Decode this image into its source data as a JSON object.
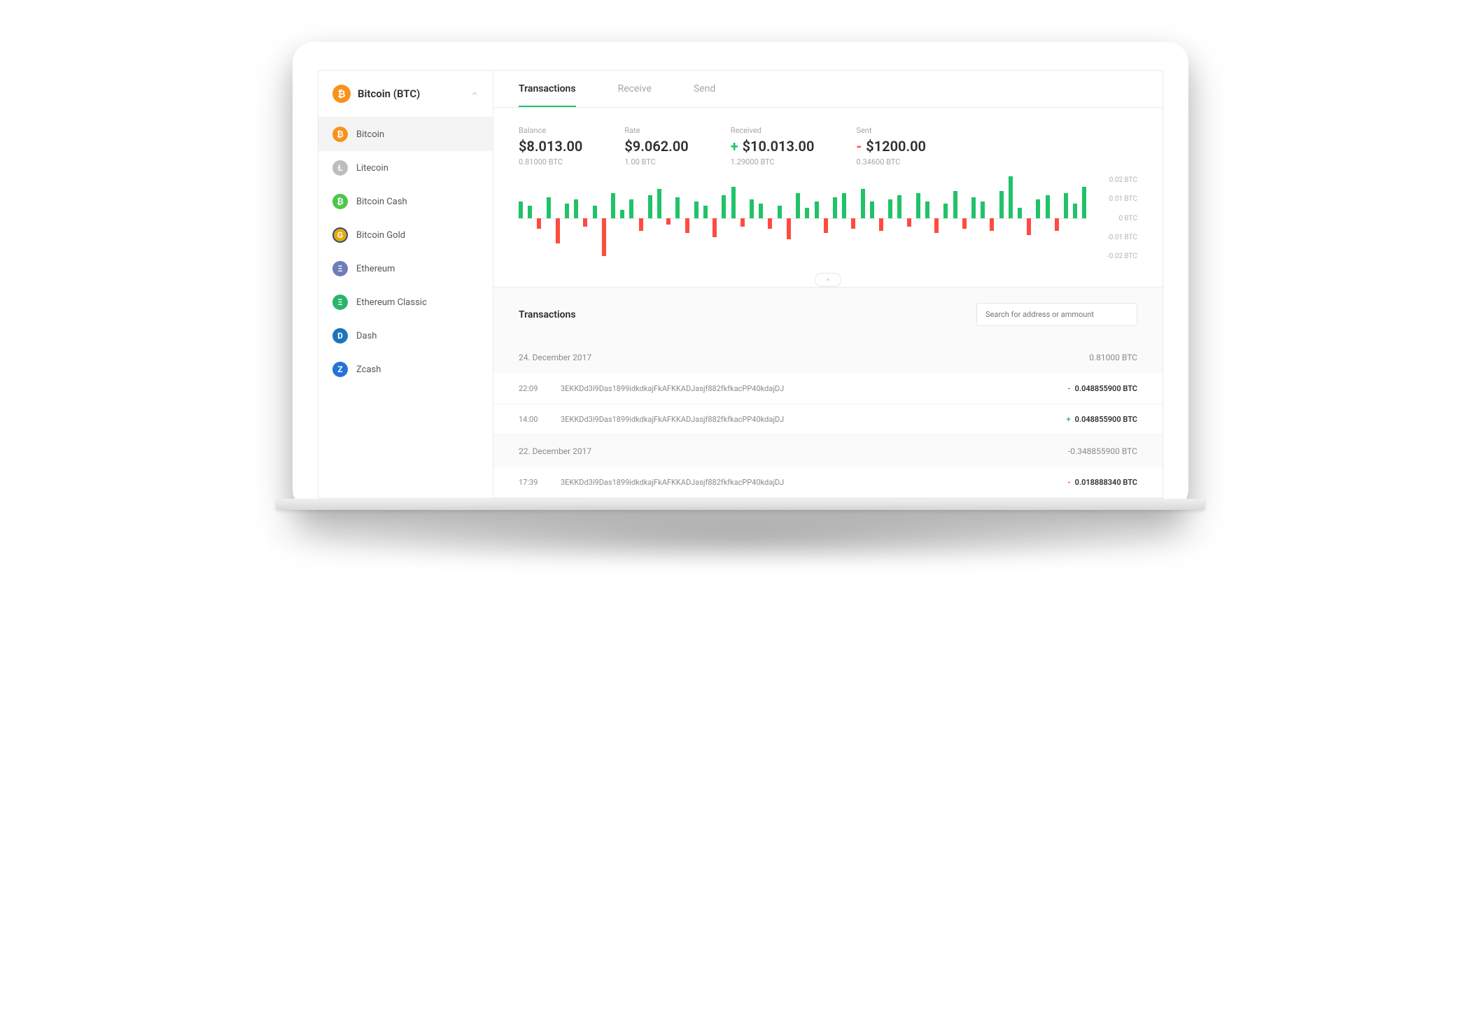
{
  "sidebar": {
    "selected": {
      "label": "Bitcoin (BTC)",
      "icon_bg": "#f7931a",
      "glyph": "₿"
    },
    "items": [
      {
        "label": "Bitcoin",
        "icon_bg": "#f7931a",
        "glyph": "₿",
        "active": true
      },
      {
        "label": "Litecoin",
        "icon_bg": "#bdbdbd",
        "glyph": "Ł",
        "active": false
      },
      {
        "label": "Bitcoin Cash",
        "icon_bg": "#4cc74a",
        "glyph": "₿",
        "active": false
      },
      {
        "label": "Bitcoin Gold",
        "icon_bg": "#eba809",
        "glyph": "G",
        "ring": "#2b4a8a",
        "active": false
      },
      {
        "label": "Ethereum",
        "icon_bg": "#6f7cba",
        "glyph": "Ξ",
        "active": false
      },
      {
        "label": "Ethereum Classic",
        "icon_bg": "#2ab56b",
        "glyph": "Ξ",
        "active": false
      },
      {
        "label": "Dash",
        "icon_bg": "#1c75bc",
        "glyph": "D",
        "active": false
      },
      {
        "label": "Zcash",
        "icon_bg": "#2573d6",
        "glyph": "Z",
        "active": false
      }
    ]
  },
  "tabs": [
    {
      "label": "Transactions",
      "active": true
    },
    {
      "label": "Receive",
      "active": false
    },
    {
      "label": "Send",
      "active": false
    }
  ],
  "stats": {
    "balance": {
      "label": "Balance",
      "value": "$8.013.00",
      "sub": "0.81000 BTC"
    },
    "rate": {
      "label": "Rate",
      "value": "$9.062.00",
      "sub": "1.00 BTC"
    },
    "received": {
      "label": "Received",
      "value": "$10.013.00",
      "sub": "1.29000 BTC",
      "sign": "+"
    },
    "sent": {
      "label": "Sent",
      "value": "$1200.00",
      "sub": "0.34600 BTC",
      "sign": "-"
    }
  },
  "chart_data": {
    "type": "bar",
    "ylabel": "BTC",
    "ylim": [
      -0.02,
      0.02
    ],
    "ticks": [
      "0.02 BTC",
      "0.01 BTC",
      "0 BTC",
      "-0.01 BTC",
      "-0.02 BTC"
    ],
    "values": [
      0.008,
      0.006,
      -0.005,
      0.01,
      -0.012,
      0.007,
      0.009,
      -0.004,
      0.006,
      -0.018,
      0.012,
      0.004,
      0.009,
      -0.006,
      0.011,
      0.014,
      -0.003,
      0.01,
      -0.007,
      0.008,
      0.006,
      -0.009,
      0.011,
      0.015,
      -0.004,
      0.009,
      0.007,
      -0.005,
      0.006,
      -0.01,
      0.012,
      0.005,
      0.008,
      -0.007,
      0.01,
      0.012,
      -0.005,
      0.014,
      0.008,
      -0.006,
      0.009,
      0.011,
      -0.004,
      0.012,
      0.008,
      -0.007,
      0.007,
      0.013,
      -0.005,
      0.01,
      0.008,
      -0.006,
      0.013,
      0.02,
      0.005,
      -0.008,
      0.009,
      0.011,
      -0.006,
      0.012,
      0.007,
      0.015
    ]
  },
  "transactions": {
    "title": "Transactions",
    "search_placeholder": "Search for address or ammount",
    "groups": [
      {
        "date": "24. December 2017",
        "total": "0.81000 BTC",
        "rows": [
          {
            "time": "22:09",
            "address": "3EKKDd3i9Das1899idkdkajFkAFKKADJasjf882fkfkacPP40kdajDJ",
            "sign": "-",
            "amount": "0.048855900 BTC"
          },
          {
            "time": "14:00",
            "address": "3EKKDd3i9Das1899idkdkajFkAFKKADJasjf882fkfkacPP40kdajDJ",
            "sign": "+",
            "amount": "0.048855900 BTC"
          }
        ]
      },
      {
        "date": "22. December 2017",
        "total": "-0.348855900 BTC",
        "rows": [
          {
            "time": "17:39",
            "address": "3EKKDd3i9Das1899idkdkajFkAFKKADJasjf882fkfkacPP40kdajDJ",
            "sign": "-",
            "amount": "0.018888340 BTC"
          }
        ]
      }
    ]
  },
  "colors": {
    "green": "#21c268",
    "red": "#ff4b3e"
  }
}
